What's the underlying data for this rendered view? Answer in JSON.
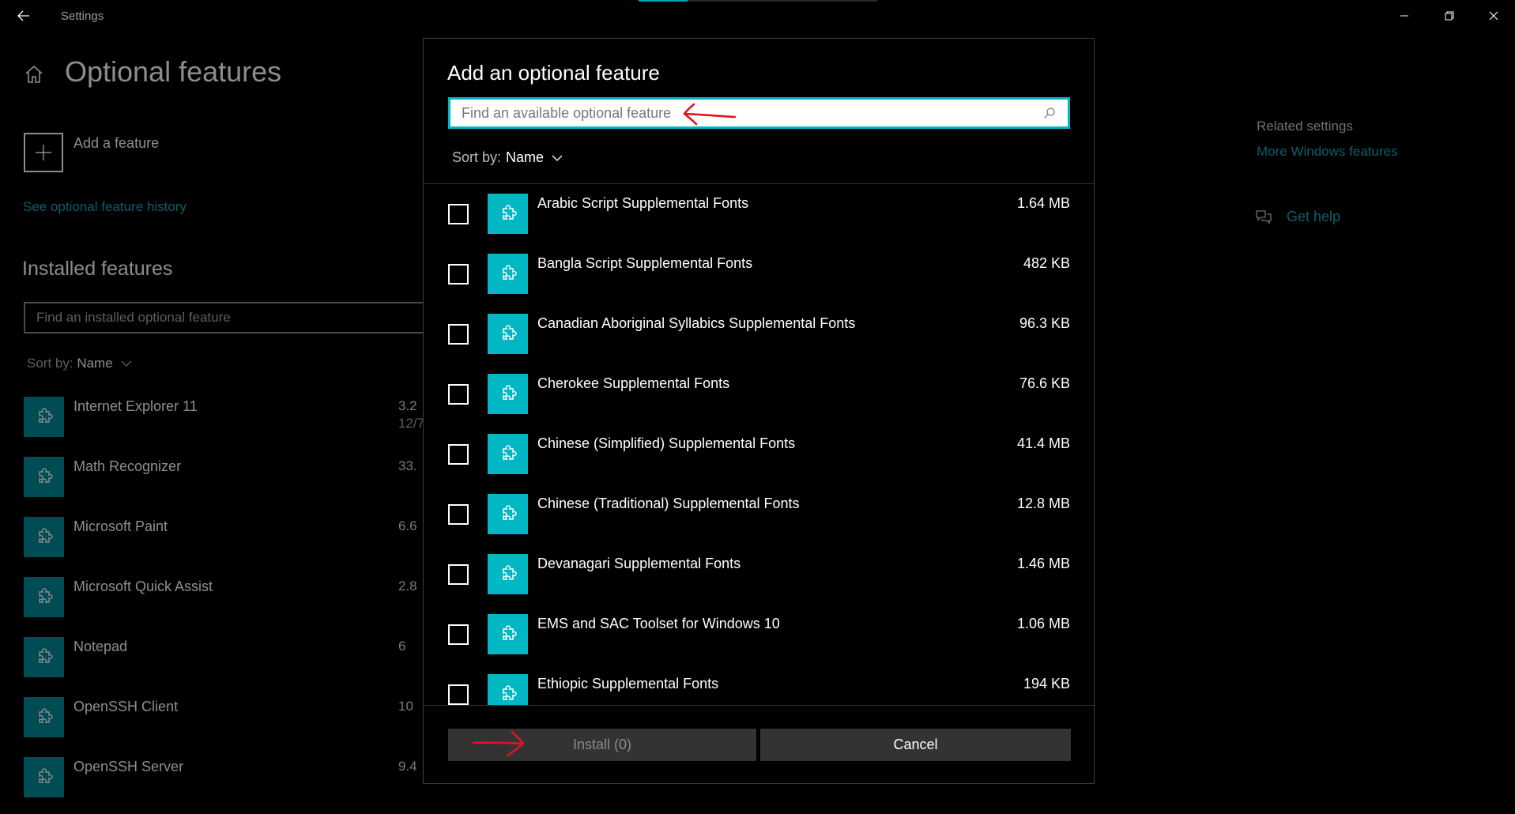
{
  "window": {
    "title": "Settings"
  },
  "page": {
    "title": "Optional features",
    "add_feature_label": "Add a feature",
    "history_link": "See optional feature history",
    "installed_heading": "Installed features",
    "installed_search_placeholder": "Find an installed optional feature",
    "sort_label": "Sort by:",
    "sort_value": "Name",
    "installed": [
      {
        "name": "Internet Explorer 11",
        "size": "3.2",
        "date": "12/7"
      },
      {
        "name": "Math Recognizer",
        "size": "33.",
        "date": ""
      },
      {
        "name": "Microsoft Paint",
        "size": "6.6",
        "date": ""
      },
      {
        "name": "Microsoft Quick Assist",
        "size": "2.8",
        "date": ""
      },
      {
        "name": "Notepad",
        "size": "6",
        "date": ""
      },
      {
        "name": "OpenSSH Client",
        "size": "10",
        "date": ""
      },
      {
        "name": "OpenSSH Server",
        "size": "9.4",
        "date": ""
      }
    ]
  },
  "related": {
    "title": "Related settings",
    "more_windows_features": "More Windows features",
    "get_help": "Get help"
  },
  "dialog": {
    "title": "Add an optional feature",
    "search_placeholder": "Find an available optional feature",
    "sort_label": "Sort by:",
    "sort_value": "Name",
    "features": [
      {
        "name": "Arabic Script Supplemental Fonts",
        "size": "1.64 MB"
      },
      {
        "name": "Bangla Script Supplemental Fonts",
        "size": "482 KB"
      },
      {
        "name": "Canadian Aboriginal Syllabics Supplemental Fonts",
        "size": "96.3 KB"
      },
      {
        "name": "Cherokee Supplemental Fonts",
        "size": "76.6 KB"
      },
      {
        "name": "Chinese (Simplified) Supplemental Fonts",
        "size": "41.4 MB"
      },
      {
        "name": "Chinese (Traditional) Supplemental Fonts",
        "size": "12.8 MB"
      },
      {
        "name": "Devanagari Supplemental Fonts",
        "size": "1.46 MB"
      },
      {
        "name": "EMS and SAC Toolset for Windows 10",
        "size": "1.06 MB"
      },
      {
        "name": "Ethiopic Supplemental Fonts",
        "size": "194 KB"
      }
    ],
    "install_label": "Install (0)",
    "cancel_label": "Cancel"
  },
  "colors": {
    "accent": "#00b7c3",
    "link": "#1ba9c3",
    "annotation": "#e0141e"
  }
}
